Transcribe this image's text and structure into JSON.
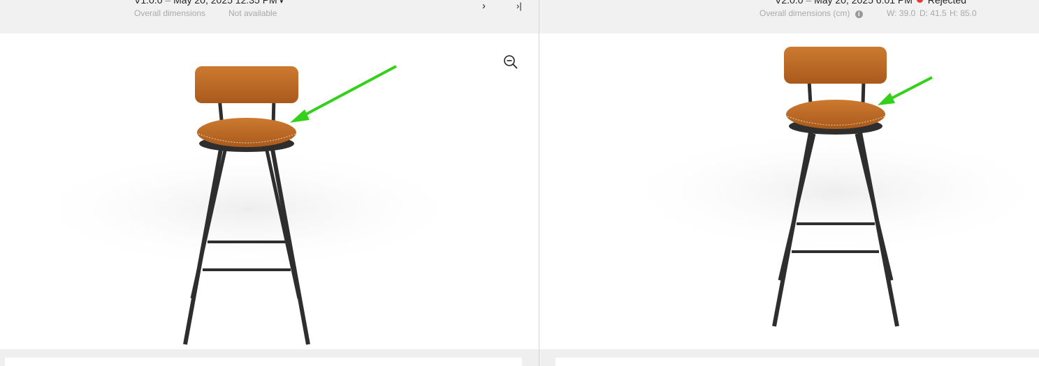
{
  "left": {
    "version": "V1.0.0",
    "date": "May 20, 2025 12:35 PM",
    "dims_label": "Overall dimensions",
    "dims_value": "Not available"
  },
  "right": {
    "version": "V2.0.0",
    "date": "May 20, 2025 6:01 PM",
    "status": "Rejected",
    "dims_label": "Overall dimensions (cm)",
    "width": "W: 39.0",
    "depth": "D: 41.5",
    "height": "H: 85.0"
  },
  "nav": {
    "next": "›",
    "last": "›|"
  },
  "colors": {
    "seat": "#bf6a24",
    "frame": "#2e2e2e",
    "arrow": "#33d11a",
    "status": "#e53935"
  },
  "icons": {
    "zoom_out": "zoom-out-icon",
    "info": "info-icon",
    "arrow": "green-arrow-annotation"
  }
}
